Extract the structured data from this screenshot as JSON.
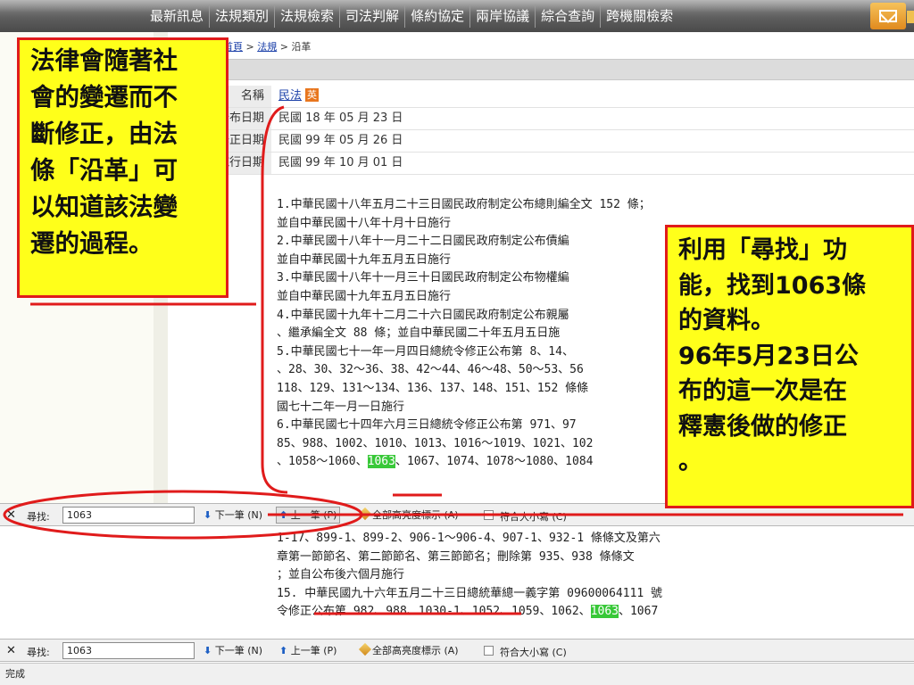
{
  "nav": {
    "items": [
      "最新訊息",
      "法規類別",
      "法規檢索",
      "司法判解",
      "條約協定",
      "兩岸協議",
      "綜合查詢",
      "跨機關檢索"
    ],
    "mail_icon": "mail-icon"
  },
  "breadcrumb": {
    "home": "首頁",
    "sep1": " > ",
    "laws": "法規",
    "sep2": " > ",
    "current": "沿革"
  },
  "info": {
    "name_label": "名稱",
    "name_value": "民法",
    "en_badge": "英",
    "date1_label": "公布日期",
    "date1_value": "民國 18 年 05 月 23 日",
    "date2_label": "修正日期",
    "date2_value": "民國 99 年 05 月 26 日",
    "date3_label": "施行日期",
    "date3_value": "民國 99 年 10 月 01 日"
  },
  "history_lines": [
    "1.中華民國十八年五月二十三日國民政府制定公布總則編全文 152  條；",
    "  並自中華民國十八年十月十日施行",
    "2.中華民國十八年十一月二十二日國民政府制定公布債編",
    "  並自中華民國十九年五月五日施行",
    "3.中華民國十八年十一月三十日國民政府制定公布物權編",
    "  並自中華民國十九年五月五日施行",
    "4.中華民國十九年十二月二十六日國民政府制定公布親屬",
    "  、繼承編全文 88 條；並自中華民國二十年五月五日施",
    "5.中華民國七十一年一月四日總統令修正公布第 8、14、",
    "  、28、30、32～36、38、42～44、46～48、50～53、56",
    "  118、129、131～134、136、137、148、151、152 條條",
    "  國七十二年一月一日施行",
    "6.中華民國七十四年六月三日總統令修正公布第 971、97",
    "  85、988、1002、1010、1013、1016～1019、1021、102"
  ],
  "history_hl_line": {
    "before": "  、1058～1060、",
    "hl": "1063",
    "after": "、1067、1074、1078～1080、1084"
  },
  "history2_lines": [
    "  1-17、899-1、899-2、906-1～906-4、907-1、932-1  條條文及第六",
    "  章第一節節名、第二節節名、第三節節名；刪除第 935、938 條條文",
    "  ；並自公布後六個月施行"
  ],
  "history2_item15": "15. 中華民國九十六年五月二十三日總統華總一義字第 09600064111  號",
  "history2_last": {
    "before": "    令修正公布第 982、988、1030-1、1052、1059、1062、",
    "hl": "1063",
    "after": "、1067"
  },
  "findbar": {
    "label": "尋找:",
    "value": "1063",
    "next": "下一筆 (N)",
    "prev": "上一筆 (P)",
    "highlight_all": "全部高亮度標示 (A)",
    "match_case": "符合大小寫 (C)"
  },
  "status": "完成",
  "notes": {
    "left": [
      "法律會隨著社",
      "會的變遷而不",
      "斷修正，由法",
      "條「沿革」可",
      "以知道該法變",
      "遷的過程。"
    ],
    "right": [
      "利用「尋找」功",
      "能，找到1063條",
      "的資料。",
      "96年5月23日公",
      "布的這一次是在",
      "釋憲後做的修正",
      "。"
    ]
  },
  "colors": {
    "annotation_fill": "#ffff1a",
    "annotation_border": "#e01b1b",
    "highlight": "#38c838",
    "link": "#1a3fa8"
  }
}
